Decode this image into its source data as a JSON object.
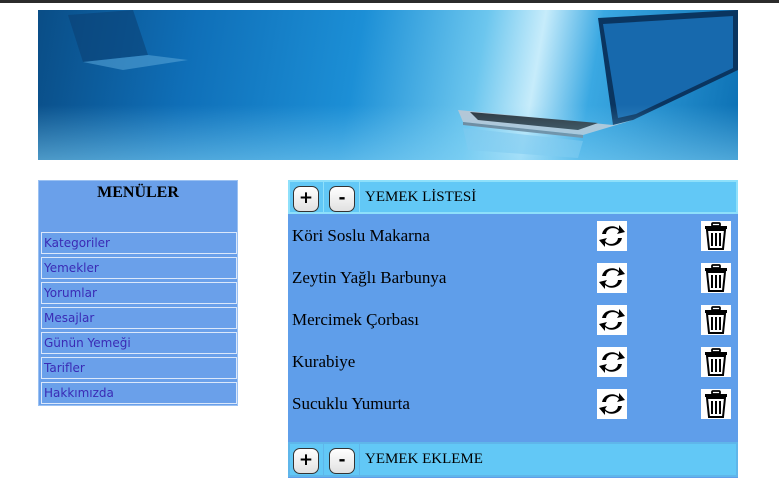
{
  "menu": {
    "title": "MENÜLER",
    "items": [
      {
        "label": "Kategoriler"
      },
      {
        "label": "Yemekler"
      },
      {
        "label": "Yorumlar"
      },
      {
        "label": "Mesajlar"
      },
      {
        "label": "Günün Yemeği"
      },
      {
        "label": "Tarifler"
      },
      {
        "label": "Hakkımızda"
      }
    ]
  },
  "food_list": {
    "header": {
      "plus": "+",
      "minus": "-",
      "title": "YEMEK LİSTESİ"
    },
    "items": [
      {
        "name": "Köri Soslu Makarna",
        "edit_icon": "refresh-icon",
        "delete_icon": "trash-icon"
      },
      {
        "name": "Zeytin Yağlı Barbunya",
        "edit_icon": "refresh-icon",
        "delete_icon": "trash-icon"
      },
      {
        "name": "Mercimek Çorbası",
        "edit_icon": "refresh-icon",
        "delete_icon": "trash-icon"
      },
      {
        "name": "Kurabiye",
        "edit_icon": "refresh-icon",
        "delete_icon": "trash-icon"
      },
      {
        "name": "Sucuklu Yumurta",
        "edit_icon": "refresh-icon",
        "delete_icon": "trash-icon"
      }
    ]
  },
  "food_add": {
    "header": {
      "plus": "+",
      "minus": "-",
      "title": "YEMEK EKLEME"
    }
  },
  "colors": {
    "menu_bg": "#6aa0ea",
    "menu_link": "#3a2bb5",
    "panel_bg": "#5f9eea",
    "bar_bg": "#62c8f6"
  }
}
